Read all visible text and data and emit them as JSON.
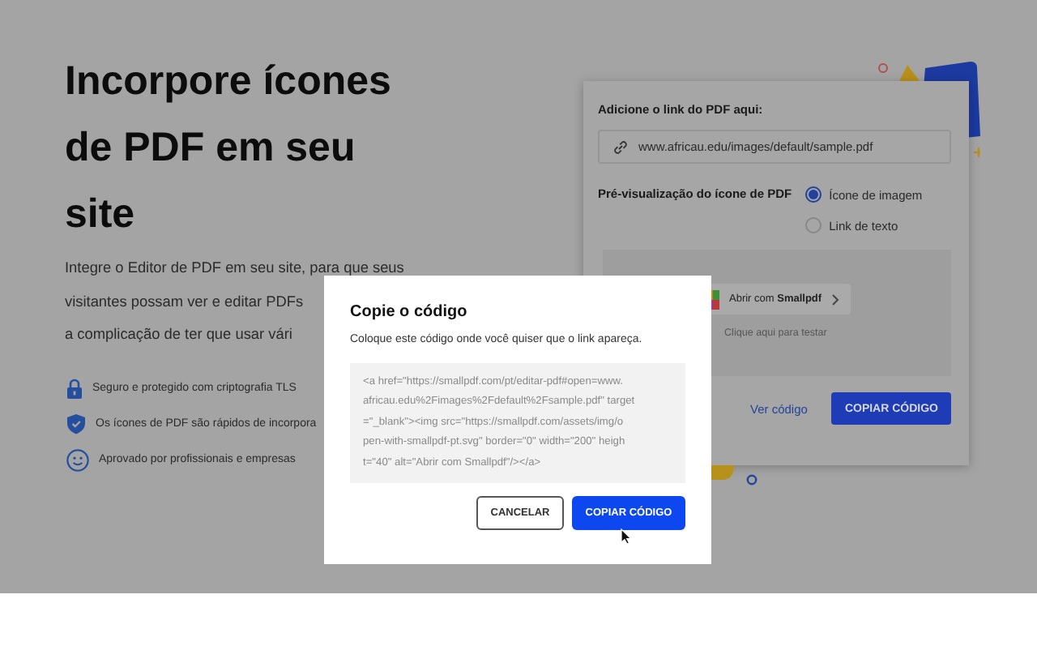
{
  "hero": {
    "title_lines": [
      "Incorpore ícones",
      "de PDF em seu",
      "site"
    ],
    "description_lines": [
      "Integre o Editor de PDF em seu site, para que seus",
      "visitantes possam ver e editar PDFs",
      "a complicação de ter que usar vári"
    ],
    "features": [
      {
        "kind": "lock",
        "text": "Seguro e protegido com criptografia TLS"
      },
      {
        "kind": "shield",
        "text": "Os ícones de PDF são rápidos de incorpora"
      },
      {
        "kind": "smiley",
        "text": "Aprovado por profissionais e empresas"
      }
    ]
  },
  "embed_card": {
    "link_label": "Adicione o link do PDF aqui:",
    "link_value": "www.africau.edu/images/default/sample.pdf",
    "preview_label": "Pré-visualização do ícone de PDF",
    "preview_options": [
      {
        "label": "Ícone de imagem",
        "selected": true
      },
      {
        "label": "Link de texto",
        "selected": false
      }
    ],
    "preview_button": "Abrir com **Smallpdf**",
    "preview_hint": "Clique aqui para testar",
    "view_code_link": "Ver código",
    "copy_button": "COPIAR CÓDIGO"
  },
  "dialog": {
    "title": "Copie o código",
    "description": "Coloque este código onde você quiser que o link apareça.",
    "code_lines": [
      "<a href=\"https://smallpdf.com/pt/editar-pdf#open=www.",
      "africau.edu%2Fimages%2Fdefault%2Fsample.pdf\" target",
      "=\"_blank\"><img src=\"https://smallpdf.com/assets/img/o",
      "pen-with-smallpdf-pt.svg\" border=\"0\" width=\"200\" heigh",
      "t=\"40\" alt=\"Abrir com Smallpdf\"/></a>"
    ],
    "cancel_button": "CANCELAR",
    "copy_button": "COPIAR CÓDIGO"
  }
}
